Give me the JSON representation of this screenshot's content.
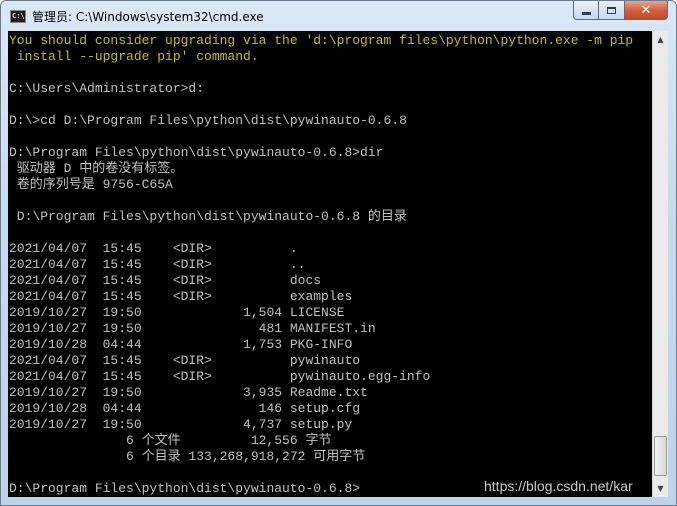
{
  "window": {
    "title": "管理员: C:\\Windows\\system32\\cmd.exe",
    "app_icon": "cmd-app-icon",
    "app_icon_text": "C:\\",
    "buttons": {
      "minimize_icon": "minimize-icon",
      "maximize_icon": "maximize-icon",
      "close_icon": "close-icon",
      "close_label": "✕"
    }
  },
  "colors": {
    "console_bg": "#000000",
    "console_text": "#c0c0c0",
    "warning_text": "#c0c000",
    "titlebar": "#c7dbef",
    "close_button": "#c9502f"
  },
  "console": {
    "lines": [
      {
        "text": "You should consider upgrading via the 'd:\\program files\\python\\python.exe -m pip",
        "kind": "warn"
      },
      {
        "text": " install --upgrade pip' command.",
        "kind": "warn"
      },
      {
        "text": "",
        "kind": "normal"
      },
      {
        "text": "C:\\Users\\Administrator>d:",
        "kind": "normal"
      },
      {
        "text": "",
        "kind": "normal"
      },
      {
        "text": "D:\\>cd D:\\Program Files\\python\\dist\\pywinauto-0.6.8",
        "kind": "normal"
      },
      {
        "text": "",
        "kind": "normal"
      },
      {
        "text": "D:\\Program Files\\python\\dist\\pywinauto-0.6.8>dir",
        "kind": "normal"
      },
      {
        "text": " 驱动器 D 中的卷没有标签。",
        "kind": "normal"
      },
      {
        "text": " 卷的序列号是 9756-C65A",
        "kind": "normal"
      },
      {
        "text": "",
        "kind": "normal"
      },
      {
        "text": " D:\\Program Files\\python\\dist\\pywinauto-0.6.8 的目录",
        "kind": "normal"
      },
      {
        "text": "",
        "kind": "normal"
      },
      {
        "text": "2021/04/07  15:45    <DIR>          .",
        "kind": "normal"
      },
      {
        "text": "2021/04/07  15:45    <DIR>          ..",
        "kind": "normal"
      },
      {
        "text": "2021/04/07  15:45    <DIR>          docs",
        "kind": "normal"
      },
      {
        "text": "2021/04/07  15:45    <DIR>          examples",
        "kind": "normal"
      },
      {
        "text": "2019/10/27  19:50             1,504 LICENSE",
        "kind": "normal"
      },
      {
        "text": "2019/10/27  19:50               481 MANIFEST.in",
        "kind": "normal"
      },
      {
        "text": "2019/10/28  04:44             1,753 PKG-INFO",
        "kind": "normal"
      },
      {
        "text": "2021/04/07  15:45    <DIR>          pywinauto",
        "kind": "normal"
      },
      {
        "text": "2021/04/07  15:45    <DIR>          pywinauto.egg-info",
        "kind": "normal"
      },
      {
        "text": "2019/10/27  19:50             3,935 Readme.txt",
        "kind": "normal"
      },
      {
        "text": "2019/10/28  04:44               146 setup.cfg",
        "kind": "normal"
      },
      {
        "text": "2019/10/27  19:50             4,737 setup.py",
        "kind": "normal"
      },
      {
        "text": "               6 个文件         12,556 字节",
        "kind": "normal"
      },
      {
        "text": "               6 个目录 133,268,918,272 可用字节",
        "kind": "normal"
      },
      {
        "text": "",
        "kind": "normal"
      },
      {
        "text": "D:\\Program Files\\python\\dist\\pywinauto-0.6.8>",
        "kind": "normal"
      }
    ]
  },
  "scrollbar": {
    "up_icon": "scroll-up-arrow-icon",
    "down_icon": "scroll-down-arrow-icon",
    "up_glyph": "▲",
    "down_glyph": "▼"
  },
  "watermark": "https://blog.csdn.net/kar"
}
